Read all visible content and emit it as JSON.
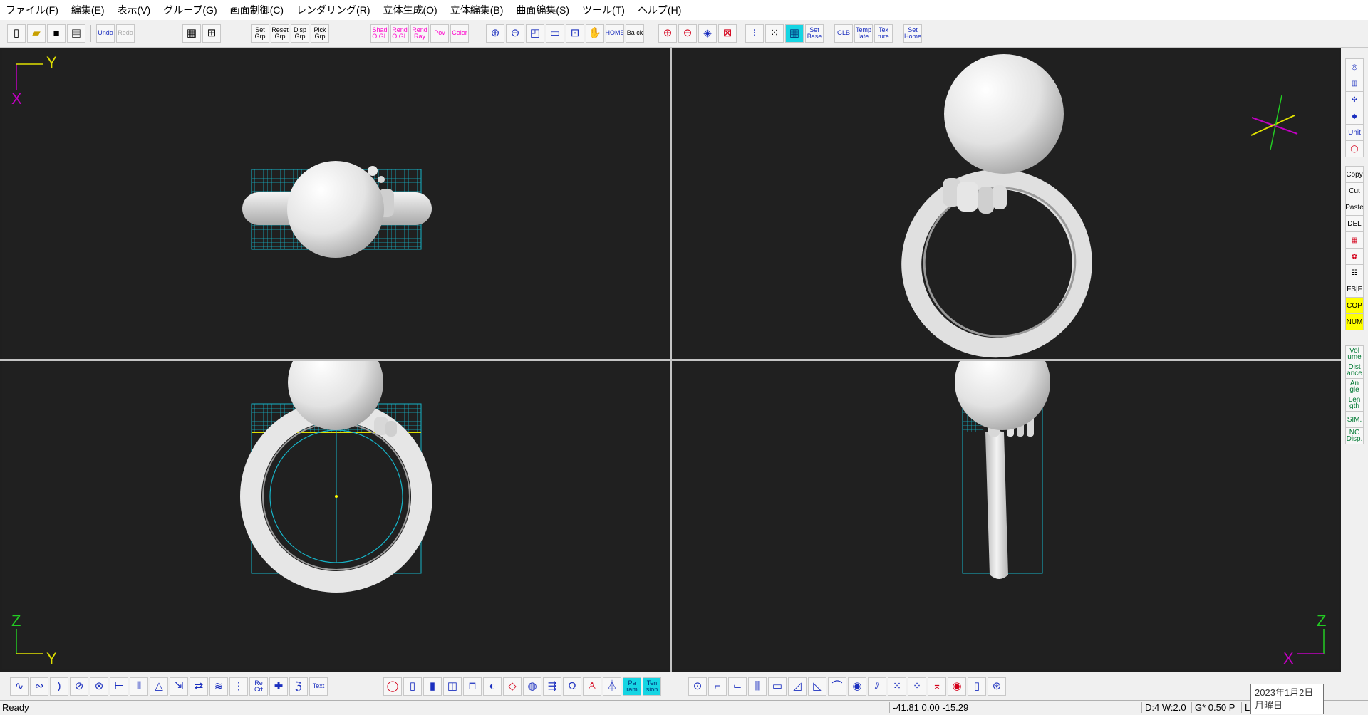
{
  "menu": [
    "ファイル(F)",
    "編集(E)",
    "表示(V)",
    "グループ(G)",
    "画面制御(C)",
    "レンダリング(R)",
    "立体生成(O)",
    "立体編集(B)",
    "曲面編集(S)",
    "ツール(T)",
    "ヘルプ(H)"
  ],
  "toolbar": {
    "undo": "Undo",
    "redo": "Redo",
    "set_grp": "Set Grp",
    "reset_grp": "Reset Grp",
    "disp_grp": "Disp Grp",
    "pick_grp": "Pick Grp",
    "shad_ogl": "Shad O.GL",
    "rend_ogl": "Rend O.GL",
    "rend_ray": "Rend Ray",
    "pov": "Pov",
    "color": "Color",
    "home": "HOME",
    "back": "Ba ck",
    "set_base": "Set Base",
    "glb": "GLB",
    "template": "Temp late",
    "texture": "Tex ture",
    "set_home": "Set Home"
  },
  "rightbar": {
    "unit": "Unit",
    "copy": "Copy",
    "cut": "Cut",
    "paste": "Paste",
    "del": "DEL",
    "fsf": "FS|F",
    "cop": "COP",
    "num": "NUM",
    "volume": "Vol ume",
    "distance": "Dist ance",
    "angle": "An gle",
    "length": "Len gth",
    "sim": "SIM.",
    "nc_disp": "NC Disp."
  },
  "bottombar": {
    "recrt": "Re Crt",
    "text": "Text",
    "param": "Pa ram",
    "tension": "Ten sion"
  },
  "axes": {
    "top_left": {
      "h": "Y",
      "v": "X"
    },
    "bottom_left": {
      "h": "Y",
      "v": "Z"
    },
    "bottom_right": {
      "h": "X",
      "v": "Z"
    }
  },
  "status": {
    "ready": "Ready",
    "coords": "-41.81 0.00 -15.29",
    "display": "D:4 W:2.0",
    "grid": "G* 0.50 P",
    "extra": "L"
  },
  "clock": {
    "date": "2023年1月2日",
    "weekday": "月曜日"
  },
  "colors": {
    "viewport_bg": "#202020",
    "grid": "#16b4c8",
    "axis_magenta": "#c000c0",
    "axis_yellow": "#e0e000",
    "model": "#e4e4e4"
  }
}
